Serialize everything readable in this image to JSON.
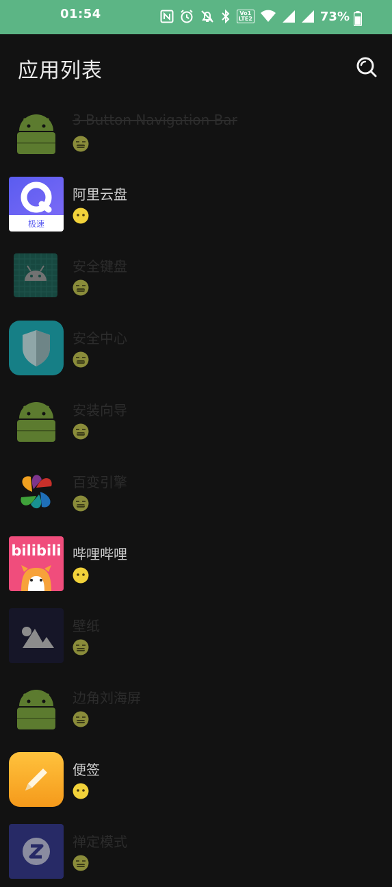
{
  "status_bar": {
    "time": "01:54",
    "battery": "73%",
    "lte_top": "Vo1",
    "lte_bottom": "LTE2",
    "background": "#5cb585"
  },
  "header": {
    "title": "应用列表",
    "search_icon": "search-icon"
  },
  "apps": [
    {
      "name": "3 Button Navigation Bar",
      "state": "disabled",
      "icon": "android-robot-icon"
    },
    {
      "name": "阿里云盘",
      "state": "enabled",
      "icon": "aliyun-drive-icon"
    },
    {
      "name": "安全键盘",
      "state": "disabled",
      "icon": "secure-keyboard-icon"
    },
    {
      "name": "安全中心",
      "state": "disabled",
      "icon": "shield-icon"
    },
    {
      "name": "安装向导",
      "state": "disabled",
      "icon": "android-robot-icon"
    },
    {
      "name": "百变引擎",
      "state": "disabled",
      "icon": "color-swirl-icon"
    },
    {
      "name": "哔哩哔哩",
      "state": "enabled",
      "icon": "bilibili-icon"
    },
    {
      "name": "壁纸",
      "state": "disabled",
      "icon": "mountain-image-icon"
    },
    {
      "name": "边角刘海屏",
      "state": "disabled",
      "icon": "android-robot-icon"
    },
    {
      "name": "便签",
      "state": "enabled",
      "icon": "notes-pencil-icon"
    },
    {
      "name": "禅定模式",
      "state": "disabled",
      "icon": "zen-mode-icon"
    }
  ],
  "icon_text": {
    "aliyun_badge": "极速",
    "bilibili_logo": "bilibili"
  },
  "colors": {
    "enabled_face": "#f2d23a",
    "disabled_face": "#8a8c3a",
    "android_green": "#5c7b2f"
  }
}
